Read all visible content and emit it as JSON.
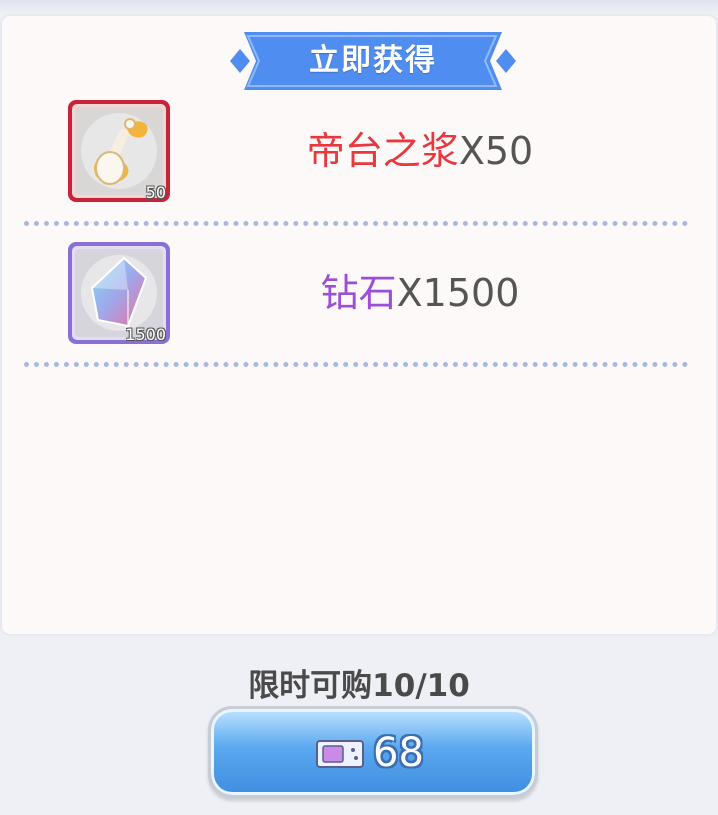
{
  "header": {
    "title": "立即获得"
  },
  "rewards": [
    {
      "name": "帝台之浆",
      "quantity_text": "X50",
      "icon_count": "50",
      "name_color": "#e8373d",
      "icon": "elixir-flask-icon"
    },
    {
      "name": "钻石",
      "quantity_text": "X1500",
      "icon_count": "1500",
      "name_color": "#9b4fd6",
      "icon": "diamond-crystal-icon"
    }
  ],
  "purchase": {
    "limit_text": "限时可购10/10",
    "price": "68",
    "currency_icon": "ticket-icon"
  },
  "colors": {
    "ribbon": "#4f8ef0",
    "button": "#5aa8ef",
    "divider": "#a5b9e3"
  }
}
